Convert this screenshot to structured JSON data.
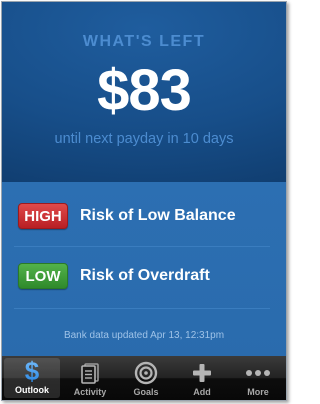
{
  "hero": {
    "heading": "WHAT'S LEFT",
    "amount": "$83",
    "subtitle": "until next payday in 10 days"
  },
  "risks": [
    {
      "level": "HIGH",
      "label": "Risk of Low Balance",
      "color": "#c62a2e"
    },
    {
      "level": "LOW",
      "label": "Risk of Overdraft",
      "color": "#3c9a36"
    }
  ],
  "status": {
    "updated": "Bank data updated Apr 13, 12:31pm"
  },
  "tabbar": {
    "active": "Outlook",
    "tabs": [
      {
        "label": "Outlook",
        "icon": "dollar-icon"
      },
      {
        "label": "Activity",
        "icon": "activity-icon"
      },
      {
        "label": "Goals",
        "icon": "target-icon"
      },
      {
        "label": "Add",
        "icon": "plus-icon"
      },
      {
        "label": "More",
        "icon": "more-icon"
      }
    ]
  },
  "colors": {
    "accent_blue": "#4c8cd0",
    "panel_blue": "#2c6fb2",
    "hero_dark": "#0f3b6c"
  }
}
